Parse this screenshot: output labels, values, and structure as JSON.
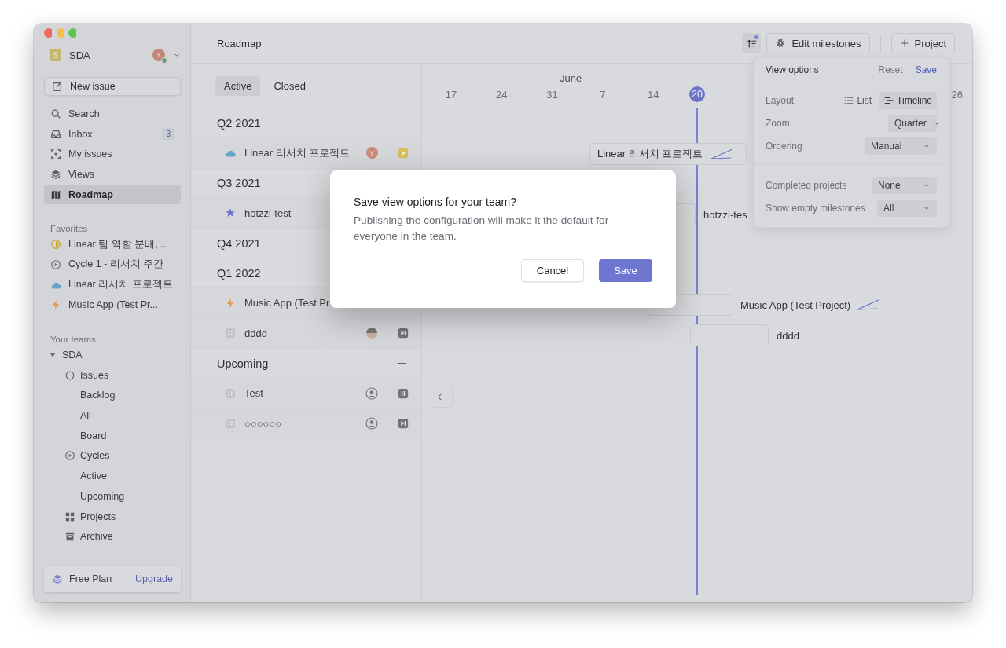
{
  "sidebar": {
    "workspace": {
      "initial": "S",
      "name": "SDA",
      "avatar_initial": "Y"
    },
    "new_issue": "New issue",
    "nav": [
      {
        "kind": "search",
        "label": "Search",
        "selected": false
      },
      {
        "kind": "inbox",
        "label": "Inbox",
        "badge": "3",
        "selected": false
      },
      {
        "kind": "my-issues",
        "label": "My issues",
        "selected": false
      },
      {
        "kind": "views",
        "label": "Views",
        "selected": false
      },
      {
        "kind": "roadmap",
        "label": "Roadmap",
        "selected": true
      }
    ],
    "favorites": {
      "title": "Favorites",
      "items": [
        {
          "kind": "half-circle",
          "label": "Linear 팀 역할 분배, ..."
        },
        {
          "kind": "cycle",
          "label": "Cycle 1 - 리서치 주간"
        },
        {
          "kind": "cloud",
          "label": "Linear 리서치 프로젝트"
        },
        {
          "kind": "bolt",
          "label": "Music App (Test Pr..."
        }
      ]
    },
    "teams": {
      "title": "Your teams",
      "items": [
        {
          "name": "SDA",
          "expanded": true,
          "children": [
            {
              "kind": "circle",
              "label": "Issues",
              "children": [
                {
                  "label": "Backlog"
                },
                {
                  "label": "All"
                },
                {
                  "label": "Board"
                }
              ]
            },
            {
              "kind": "cycle",
              "label": "Cycles",
              "children": [
                {
                  "label": "Active"
                },
                {
                  "label": "Upcoming"
                }
              ]
            },
            {
              "kind": "grid",
              "label": "Projects"
            },
            {
              "kind": "archive",
              "label": "Archive"
            }
          ]
        }
      ]
    },
    "plan": {
      "label": "Free Plan",
      "link": "Upgrade"
    }
  },
  "header": {
    "title": "Roadmap",
    "edit_button": "Edit milestones",
    "project_button": "Project"
  },
  "tabs": [
    {
      "label": "Active",
      "selected": true
    },
    {
      "label": "Closed",
      "selected": false
    }
  ],
  "groups": [
    {
      "title": "Q2 2021",
      "add": true,
      "projects": [
        {
          "kind": "cloud",
          "name": "Linear 리서치 프로젝트",
          "lead": {
            "kind": "letter",
            "initial": "Y"
          },
          "status": {
            "kind": "play"
          }
        }
      ]
    },
    {
      "title": "Q3 2021",
      "projects": [
        {
          "kind": "star",
          "name": "hotzzi-test"
        }
      ]
    },
    {
      "title": "Q4 2021"
    },
    {
      "title": "Q1 2022",
      "projects": [
        {
          "kind": "bolt",
          "name": "Music App (Test Pr"
        },
        {
          "kind": "grid-box",
          "name": "dddd",
          "lead": {
            "kind": "photo"
          },
          "status": {
            "kind": "skip"
          }
        }
      ]
    },
    {
      "title": "Upcoming",
      "add": true,
      "projects": [
        {
          "kind": "grid-box",
          "name": "Test",
          "lead": {
            "kind": "none"
          },
          "status": {
            "kind": "pause"
          }
        },
        {
          "kind": "grid-box",
          "name": "○○○○○○",
          "lead": {
            "kind": "none"
          },
          "status": {
            "kind": "skip"
          }
        }
      ]
    }
  ],
  "timeline": {
    "month": "June",
    "dates": [
      "17",
      "24",
      "31",
      "7",
      "14"
    ],
    "today": "20",
    "edge_date": "26",
    "bars": [
      {
        "kind": "inside",
        "label": "Linear 리서치 프로젝트",
        "progress": true
      },
      {
        "kind": "outside",
        "label": "hotzzi-tes",
        "progress": false
      },
      {
        "kind": "outside",
        "label": "Music App (Test Project)",
        "progress": true
      },
      {
        "kind": "outside",
        "label": "dddd",
        "progress": false
      }
    ]
  },
  "view_options": {
    "title": "View options",
    "reset": "Reset",
    "save": "Save",
    "rows": [
      {
        "kind": "segmented",
        "label": "Layout",
        "options": [
          {
            "kind": "list",
            "label": "List",
            "selected": false
          },
          {
            "kind": "timeline",
            "label": "Timeline",
            "selected": true
          }
        ]
      },
      {
        "kind": "dropdown",
        "label": "Zoom",
        "value": "Quarter"
      },
      {
        "kind": "dropdown",
        "label": "Ordering",
        "value": "Manual"
      },
      {
        "kind": "divider"
      },
      {
        "kind": "dropdown",
        "label": "Completed projects",
        "value": "None"
      },
      {
        "kind": "dropdown",
        "label": "Show empty milestones",
        "value": "All"
      }
    ]
  },
  "dialog": {
    "title": "Save view options for your team?",
    "body": "Publishing the configuration will make it the default for everyone in the team.",
    "cancel": "Cancel",
    "confirm": "Save"
  }
}
